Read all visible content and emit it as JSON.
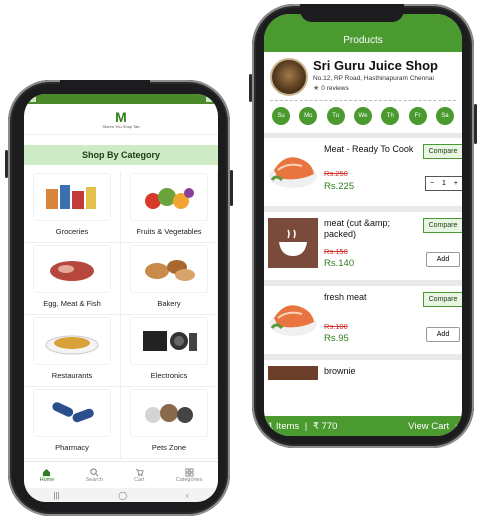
{
  "left_app": {
    "logo": {
      "mark": "M",
      "tagline": "Stores You Shop Tab"
    },
    "section_title": "Shop By Category",
    "categories": [
      {
        "label": "Groceries",
        "icon": "groceries-icon"
      },
      {
        "label": "Fruits & Vegetables",
        "icon": "fruits-vegetables-icon"
      },
      {
        "label": "Egg, Meat & Fish",
        "icon": "egg-meat-fish-icon"
      },
      {
        "label": "Bakery",
        "icon": "bakery-icon"
      },
      {
        "label": "Restaurants",
        "icon": "restaurants-icon"
      },
      {
        "label": "Electronics",
        "icon": "electronics-icon"
      },
      {
        "label": "Pharmacy",
        "icon": "pharmacy-icon"
      },
      {
        "label": "Pets Zone",
        "icon": "pets-zone-icon"
      }
    ],
    "bottom_nav": [
      {
        "label": "Home",
        "icon": "home-icon",
        "active": true
      },
      {
        "label": "Search",
        "icon": "search-icon",
        "active": false
      },
      {
        "label": "Cart",
        "icon": "cart-icon",
        "active": false
      },
      {
        "label": "Categories",
        "icon": "categories-icon",
        "active": false
      }
    ],
    "system_nav": {
      "recent": "|||",
      "home": "◯",
      "back": "‹"
    }
  },
  "right_app": {
    "title": "Products",
    "shop": {
      "name": "Sri Guru Juice Shop",
      "address": "No.12, RP Road,  Hasthinapuram  Chennai",
      "reviews": "0 reviews"
    },
    "days": [
      "Su",
      "Mo",
      "Tu",
      "We",
      "Th",
      "Fr",
      "Sa"
    ],
    "products": [
      {
        "name": "Meat - Ready To Cook",
        "old_price": "Rs.250",
        "price": "Rs.225",
        "compare_label": "Compare",
        "qty": "1",
        "minus": "−",
        "plus": "+"
      },
      {
        "name": "meat (cut &amp; packed)",
        "old_price": "Rs.150",
        "price": "Rs.140",
        "compare_label": "Compare",
        "add_label": "Add"
      },
      {
        "name": "fresh meat",
        "old_price": "Rs.100",
        "price": "Rs.95",
        "compare_label": "Compare",
        "add_label": "Add"
      },
      {
        "name": "brownie"
      }
    ],
    "cart_bar": {
      "items": "1 Items",
      "divider": "|",
      "total": "₹ 770",
      "view_cart": "View Cart",
      "chevron": "›"
    },
    "colors": {
      "brand_green": "#4a9a2f",
      "price_green": "#2e7d1e",
      "strike_red": "#d32f2f"
    }
  }
}
